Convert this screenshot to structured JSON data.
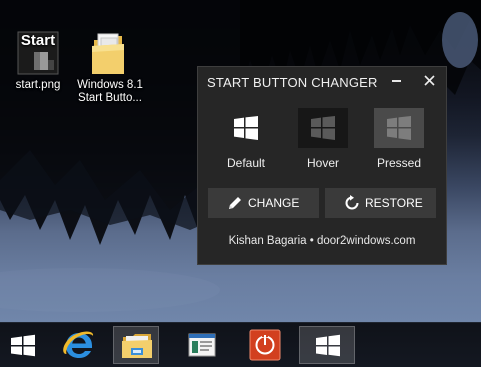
{
  "desktop": {
    "icons": [
      {
        "label": "start.png",
        "thumb_text": "Start",
        "icon": "png-image-icon"
      },
      {
        "label_line1": "Windows 8.1",
        "label_line2": "Start Butto...",
        "icon": "folder-icon"
      }
    ]
  },
  "dialog": {
    "title": "START BUTTON CHANGER",
    "states": [
      {
        "label": "Default",
        "color": "#262626"
      },
      {
        "label": "Hover",
        "color": "#1a1a1a"
      },
      {
        "label": "Pressed",
        "color": "#5a5a5a"
      }
    ],
    "change_label": "CHANGE",
    "restore_label": "RESTORE",
    "credit": "Kishan Bagaria • door2windows.com"
  },
  "taskbar": {
    "items": [
      {
        "name": "start-button",
        "icon": "windows-logo-icon"
      },
      {
        "name": "internet-explorer",
        "icon": "ie-icon"
      },
      {
        "name": "file-explorer",
        "icon": "folder-icon"
      },
      {
        "name": "window-app",
        "icon": "window-icon"
      },
      {
        "name": "power-app",
        "icon": "power-icon"
      },
      {
        "name": "start-button-changer",
        "icon": "windows-logo-icon"
      }
    ]
  },
  "colors": {
    "dialog_bg": "#262626",
    "button_bg": "#3a3a3a",
    "power_red": "#d2401f",
    "ie_blue": "#2b8fe0"
  }
}
